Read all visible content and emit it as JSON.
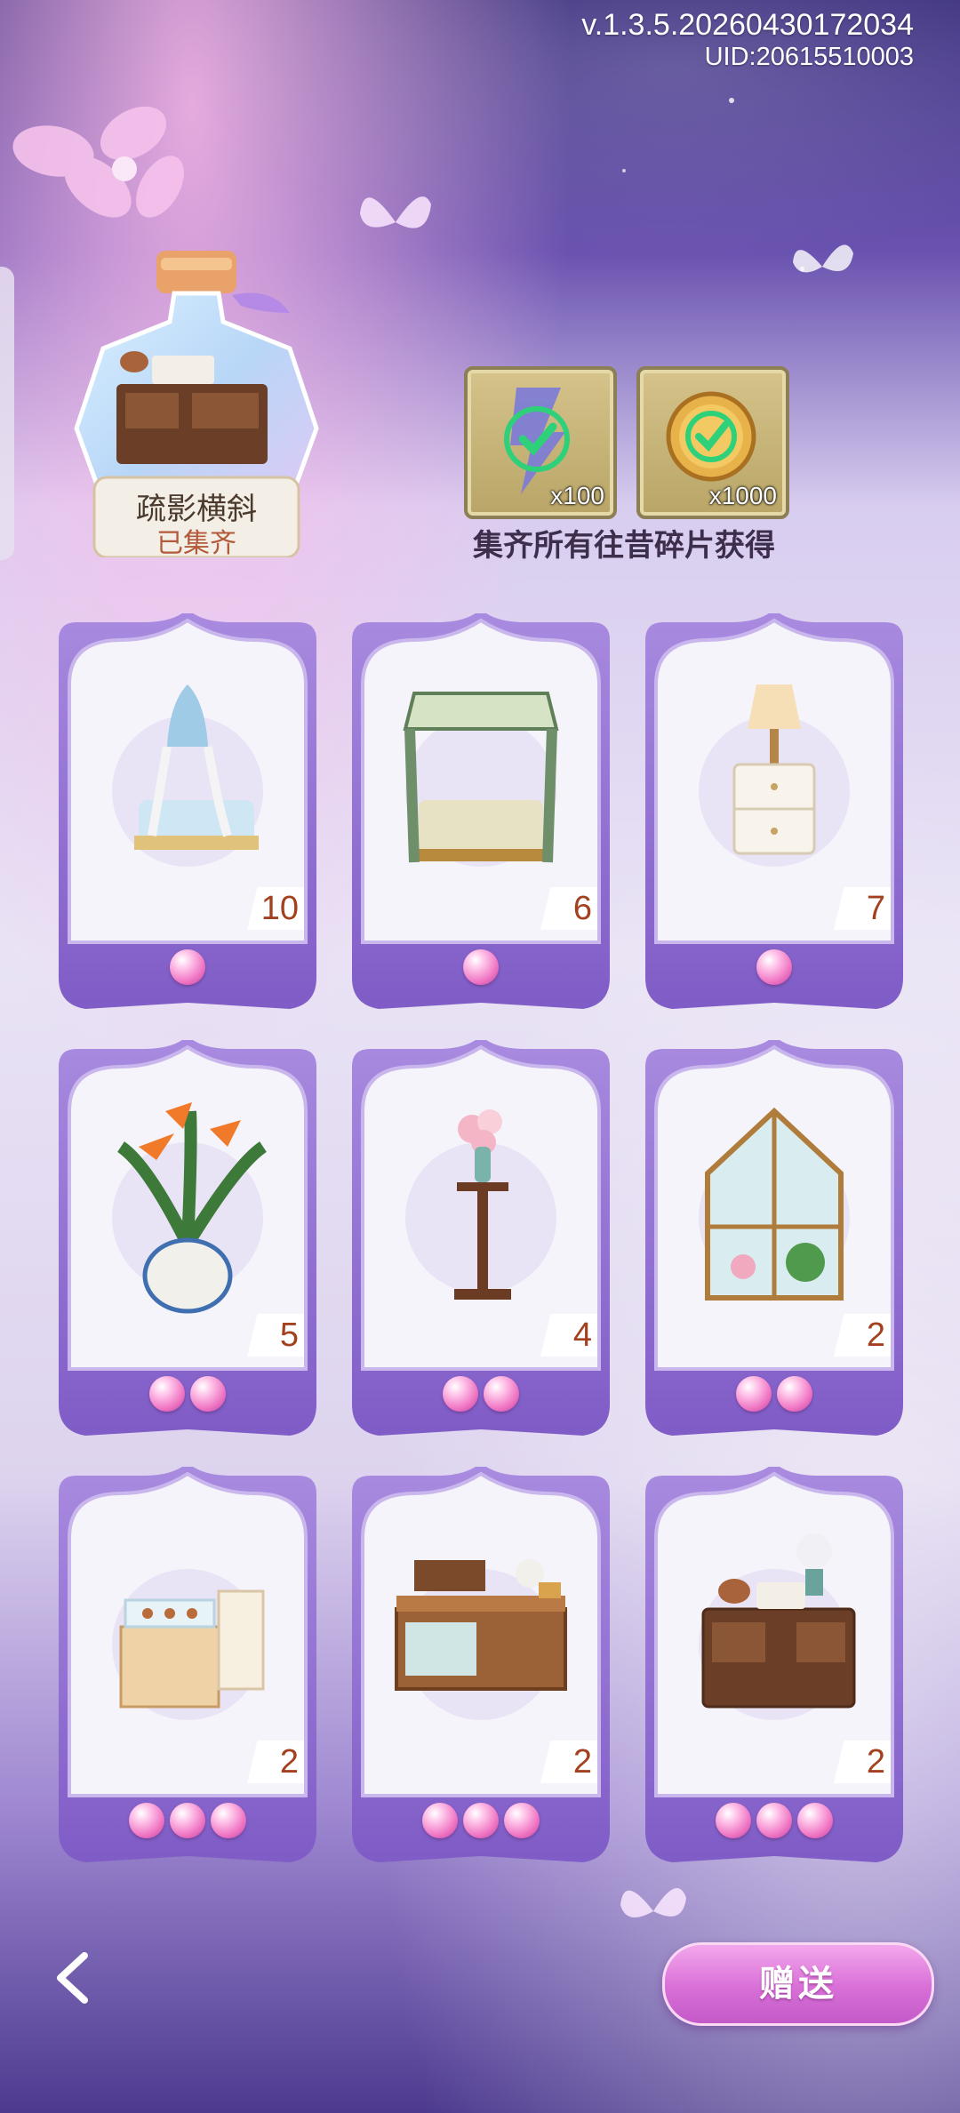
{
  "header": {
    "version": "v.1.3.5.20260430172034",
    "uid": "UID:20615510003"
  },
  "set": {
    "name": "疏影横斜",
    "status": "已集齐"
  },
  "rewards": {
    "items": [
      {
        "icon": "stamina-badge-icon",
        "qty": "x100"
      },
      {
        "icon": "clover-coin-icon",
        "qty": "x1000"
      }
    ],
    "caption": "集齐所有往昔碎片获得"
  },
  "cards": [
    {
      "icon": "canopy-bed-blue-icon",
      "count": "10",
      "pearls": 1
    },
    {
      "icon": "four-poster-bed-green-icon",
      "count": "6",
      "pearls": 1
    },
    {
      "icon": "nightstand-lamp-icon",
      "count": "7",
      "pearls": 1
    },
    {
      "icon": "bird-of-paradise-plant-icon",
      "count": "5",
      "pearls": 2
    },
    {
      "icon": "flower-stand-vase-icon",
      "count": "4",
      "pearls": 2
    },
    {
      "icon": "greenhouse-icon",
      "count": "2",
      "pearls": 2
    },
    {
      "icon": "display-counter-icon",
      "count": "2",
      "pearls": 3
    },
    {
      "icon": "wooden-shop-counter-icon",
      "count": "2",
      "pearls": 3
    },
    {
      "icon": "vanity-desk-icon",
      "count": "2",
      "pearls": 3
    }
  ],
  "footer": {
    "back_icon": "back-arrow-icon",
    "gift_label": "赠送"
  },
  "colors": {
    "card_purple": "#8f6ad0",
    "pearl_pink": "#ef74c3",
    "count_text": "#a3411f",
    "gift_button": "#d86fd7"
  }
}
